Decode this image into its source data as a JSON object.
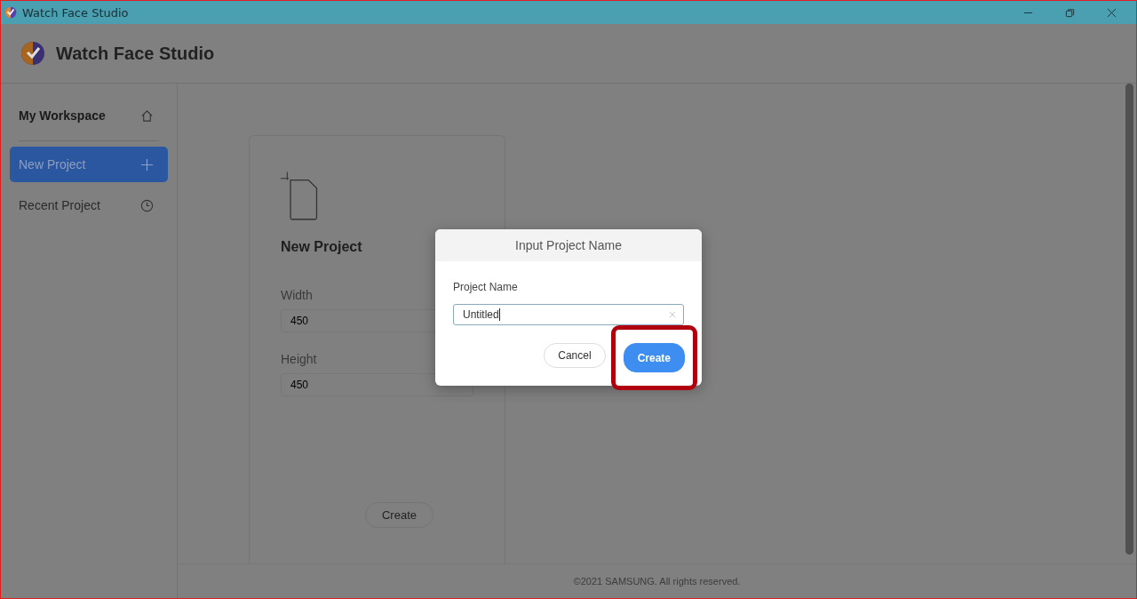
{
  "window": {
    "title": "Watch Face Studio"
  },
  "header": {
    "app_name": "Watch Face Studio"
  },
  "sidebar": {
    "items": [
      {
        "label": "My Workspace",
        "selected": false
      },
      {
        "label": "New Project",
        "selected": true
      },
      {
        "label": "Recent Project",
        "selected": false
      }
    ]
  },
  "new_project_card": {
    "title": "New Project",
    "fields": [
      {
        "label": "Width",
        "value": "450"
      },
      {
        "label": "Height",
        "value": "450"
      }
    ],
    "button": "Create"
  },
  "footer": "©2021 SAMSUNG. All rights reserved.",
  "dialog": {
    "title": "Input Project Name",
    "field_label": "Project Name",
    "value": "Untitled",
    "buttons": [
      {
        "label": "Cancel",
        "kind": "secondary",
        "highlighted": false
      },
      {
        "label": "Create",
        "kind": "primary",
        "highlighted": true
      }
    ]
  }
}
